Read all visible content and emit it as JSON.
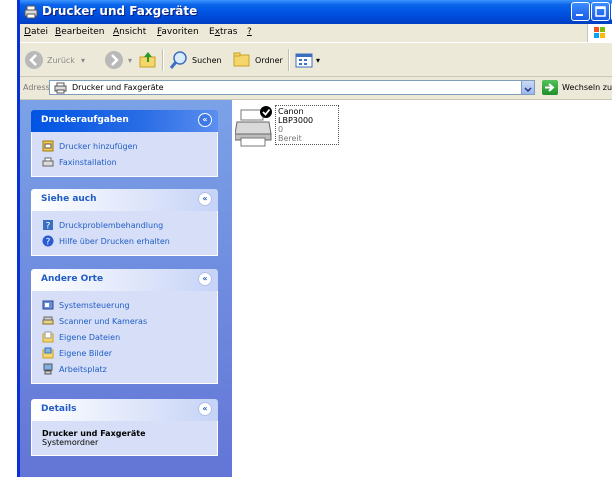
{
  "window": {
    "title": "Drucker und Faxgeräte"
  },
  "menu": [
    {
      "pre": "",
      "u": "D",
      "post": "atei"
    },
    {
      "pre": "",
      "u": "B",
      "post": "earbeiten"
    },
    {
      "pre": "",
      "u": "A",
      "post": "nsicht"
    },
    {
      "pre": "",
      "u": "F",
      "post": "avoriten"
    },
    {
      "pre": "E",
      "u": "x",
      "post": "tras"
    },
    {
      "pre": "",
      "u": "?",
      "post": ""
    }
  ],
  "toolbar": {
    "back_label": "Zurück",
    "search_label": "Suchen",
    "folders_label": "Ordner"
  },
  "address": {
    "label": "Adresse",
    "value": "Drucker und Faxgeräte",
    "go_label": "Wechseln zu"
  },
  "sidebar": {
    "tasks": {
      "title": "Druckeraufgaben",
      "items": [
        "Drucker hinzufügen",
        "Faxinstallation"
      ]
    },
    "see_also": {
      "title": "Siehe auch",
      "items": [
        "Druckproblembehandlung",
        "Hilfe über Drucken erhalten"
      ]
    },
    "other_places": {
      "title": "Andere Orte",
      "items": [
        "Systemsteuerung",
        "Scanner und Kameras",
        "Eigene Dateien",
        "Eigene Bilder",
        "Arbeitsplatz"
      ]
    },
    "details": {
      "title": "Details",
      "name": "Drucker und Faxgeräte",
      "type": "Systemordner"
    }
  },
  "printer": {
    "name": "Canon LBP3000",
    "jobs": "0",
    "status": "Bereit"
  }
}
